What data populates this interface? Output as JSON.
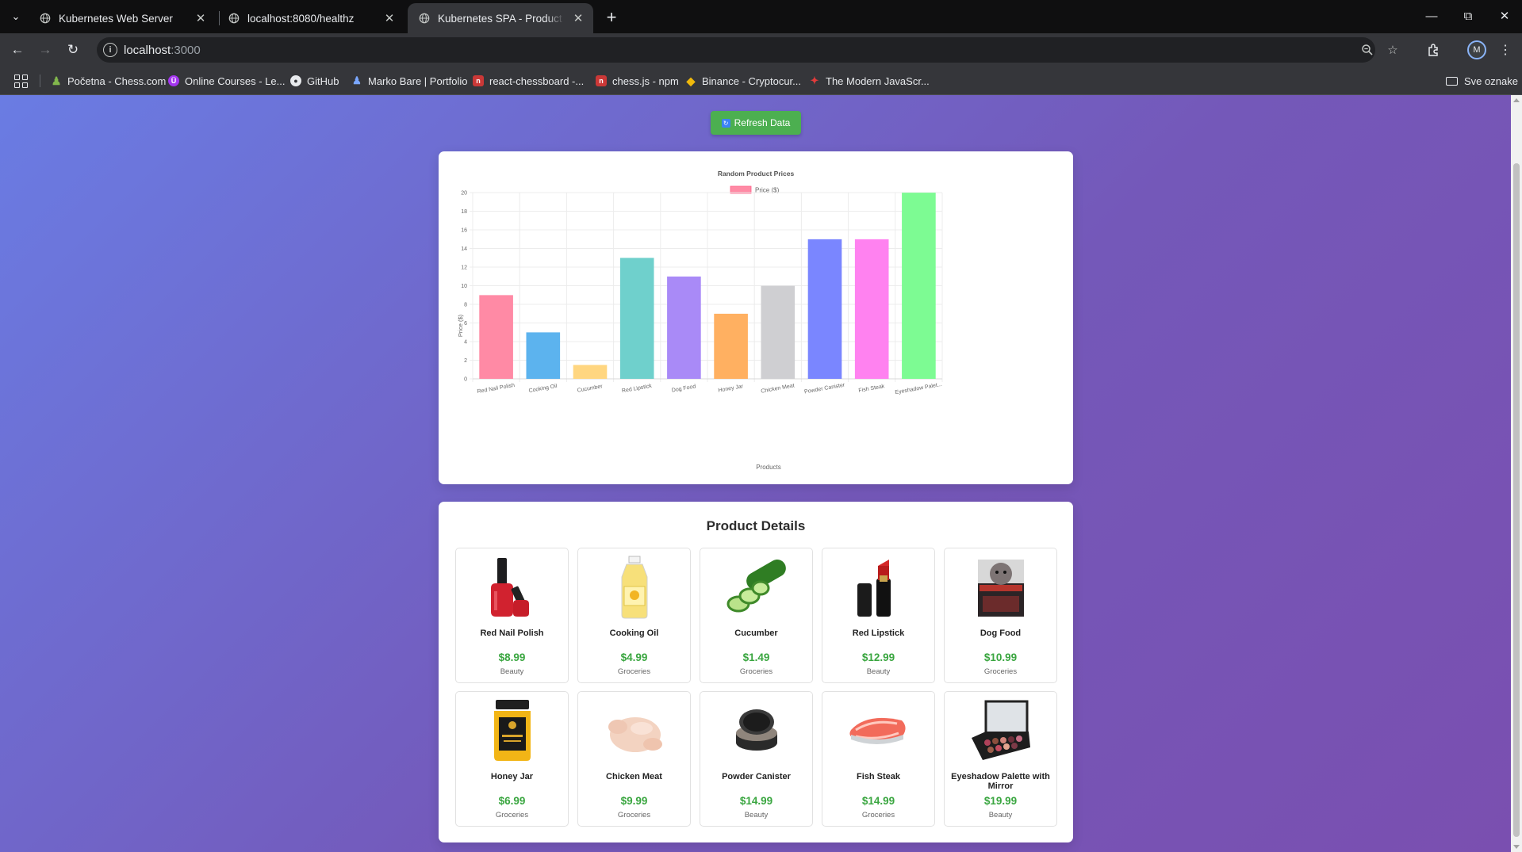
{
  "browser": {
    "tabs": [
      {
        "title": "Kubernetes Web Server",
        "active": false
      },
      {
        "title": "localhost:8080/healthz",
        "active": false
      },
      {
        "title": "Kubernetes SPA - Product Dashboard",
        "active": true
      }
    ],
    "url_host": "localhost",
    "url_port": ":3000",
    "avatar_letter": "M",
    "bookmarks": [
      {
        "label": "Početna - Chess.com",
        "icon": "chess-pawn-icon",
        "color": "#81b64c"
      },
      {
        "label": "Online Courses - Le...",
        "icon": "udemy-icon",
        "color": "#a435f0"
      },
      {
        "label": "GitHub",
        "icon": "github-icon",
        "color": "#e8eaed"
      },
      {
        "label": "Marko Bare | Portfolio",
        "icon": "person-icon",
        "color": "#7aa7ff"
      },
      {
        "label": "react-chessboard -...",
        "icon": "npm-icon",
        "color": "#cb3837"
      },
      {
        "label": "chess.js - npm",
        "icon": "npm-icon",
        "color": "#cb3837"
      },
      {
        "label": "Binance - Cryptocur...",
        "icon": "binance-icon",
        "color": "#f0b90b"
      },
      {
        "label": "The Modern JavaScr...",
        "icon": "js-info-icon",
        "color": "#e23b3b"
      }
    ],
    "bookmarks_folder": "Sve oznake"
  },
  "page": {
    "refresh_label": "Refresh Data",
    "details_title": "Product Details"
  },
  "chart_data": {
    "type": "bar",
    "title": "Random Product Prices",
    "legend": "Price ($)",
    "xlabel": "Products",
    "ylabel": "Price ($)",
    "ylim": [
      0,
      20
    ],
    "yticks": [
      0,
      2,
      4,
      6,
      8,
      10,
      12,
      14,
      16,
      18,
      20
    ],
    "categories": [
      "Red Nail Polish",
      "Cooking Oil",
      "Cucumber",
      "Red Lipstick",
      "Dog Food",
      "Honey Jar",
      "Chicken Meat",
      "Powder Canister",
      "Fish Steak",
      "Eyeshadow Palet..."
    ],
    "values": [
      8.99,
      4.99,
      1.49,
      12.99,
      10.99,
      6.99,
      9.99,
      14.99,
      14.99,
      19.99
    ],
    "colors": [
      "#ff8aa5",
      "#5cb3ee",
      "#ffd680",
      "#6fd0cc",
      "#a98af7",
      "#ffb061",
      "#cfcfd2",
      "#7a86ff",
      "#ff82f0",
      "#7dfb93"
    ],
    "grid": true,
    "legend_position": "top"
  },
  "products": [
    {
      "name": "Red Nail Polish",
      "price": "$8.99",
      "category": "Beauty",
      "icon": "nail-polish-icon"
    },
    {
      "name": "Cooking Oil",
      "price": "$4.99",
      "category": "Groceries",
      "icon": "oil-bottle-icon"
    },
    {
      "name": "Cucumber",
      "price": "$1.49",
      "category": "Groceries",
      "icon": "cucumber-icon"
    },
    {
      "name": "Red Lipstick",
      "price": "$12.99",
      "category": "Beauty",
      "icon": "lipstick-icon"
    },
    {
      "name": "Dog Food",
      "price": "$10.99",
      "category": "Groceries",
      "icon": "dog-food-bag-icon"
    },
    {
      "name": "Honey Jar",
      "price": "$6.99",
      "category": "Groceries",
      "icon": "honey-jar-icon"
    },
    {
      "name": "Chicken Meat",
      "price": "$9.99",
      "category": "Groceries",
      "icon": "chicken-icon"
    },
    {
      "name": "Powder Canister",
      "price": "$14.99",
      "category": "Beauty",
      "icon": "powder-compact-icon"
    },
    {
      "name": "Fish Steak",
      "price": "$14.99",
      "category": "Groceries",
      "icon": "fish-steak-icon"
    },
    {
      "name": "Eyeshadow Palette with Mirror",
      "price": "$19.99",
      "category": "Beauty",
      "icon": "eyeshadow-palette-icon"
    }
  ]
}
